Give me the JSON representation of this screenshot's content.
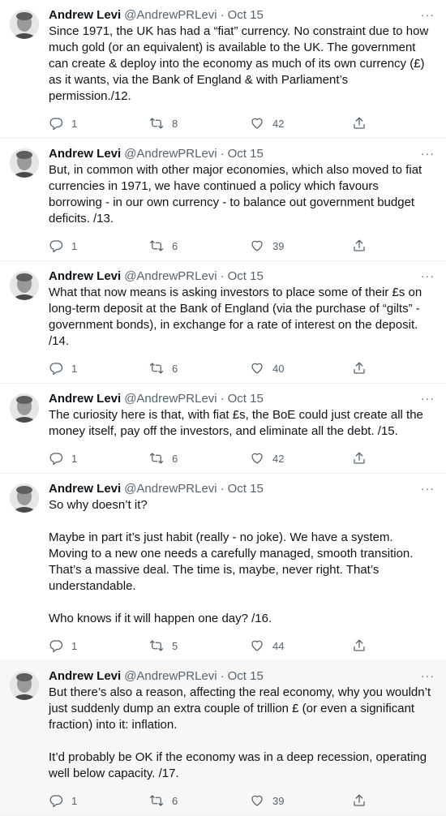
{
  "colors": {
    "text": "#0f1419",
    "secondary": "#536471",
    "divider": "#eff3f4",
    "highlight_bg": "#f7f7f7"
  },
  "icons": {
    "reply": "reply-icon",
    "retweet": "retweet-icon",
    "like": "heart-icon",
    "share": "share-icon",
    "more": "more-icon"
  },
  "tweets": [
    {
      "name": "Andrew Levi",
      "handle": "@AndrewPRLevi",
      "sep": "·",
      "date": "Oct 15",
      "more": "···",
      "paragraphs": [
        "Since 1971, the UK has had a “fiat” currency. No constraint due to how much gold (or an equivalent) is available to the UK. The government can create & deploy into the economy as much of its own currency (£) as it wants, via the Bank of England & with Parliament’s permission./12."
      ],
      "replies": "1",
      "retweets": "8",
      "likes": "42"
    },
    {
      "name": "Andrew Levi",
      "handle": "@AndrewPRLevi",
      "sep": "·",
      "date": "Oct 15",
      "more": "···",
      "paragraphs": [
        "But, in common with other major economies, which also moved to fiat currencies in 1971, we have continued a policy which favours borrowing - in our own currency - to balance out government budget deficits. /13."
      ],
      "replies": "1",
      "retweets": "6",
      "likes": "39"
    },
    {
      "name": "Andrew Levi",
      "handle": "@AndrewPRLevi",
      "sep": "·",
      "date": "Oct 15",
      "more": "···",
      "paragraphs": [
        "What that now means is asking investors to place some of their £s on long-term deposit at the Bank of England (via the purchase of “gilts” - government bonds), in exchange for a rate of interest on the deposit. /14."
      ],
      "replies": "1",
      "retweets": "6",
      "likes": "40"
    },
    {
      "name": "Andrew Levi",
      "handle": "@AndrewPRLevi",
      "sep": "·",
      "date": "Oct 15",
      "more": "···",
      "paragraphs": [
        "The curiosity here is that, with fiat £s, the BoE could just create all the money itself, pay off the investors, and eliminate all the debt. /15."
      ],
      "replies": "1",
      "retweets": "6",
      "likes": "42"
    },
    {
      "name": "Andrew Levi",
      "handle": "@AndrewPRLevi",
      "sep": "·",
      "date": "Oct 15",
      "more": "···",
      "paragraphs": [
        "So why doesn’t it?",
        "Maybe in part it’s just habit (really - no joke). We have a system. Moving to a new one needs a carefully managed, smooth transition. That’s a massive deal. The time is, maybe, never right. That’s understandable.",
        "Who knows if it will happen one day? /16."
      ],
      "replies": "1",
      "retweets": "5",
      "likes": "44"
    },
    {
      "name": "Andrew Levi",
      "handle": "@AndrewPRLevi",
      "sep": "·",
      "date": "Oct 15",
      "more": "···",
      "highlight": true,
      "paragraphs": [
        "But there’s also a reason, affecting the real economy, why you wouldn’t just suddenly dump an extra couple of trillion £ (or even a significant fraction) into it: inflation.",
        "It’d probably be OK if the economy was in a deep recession, operating well below capacity. /17."
      ],
      "replies": "1",
      "retweets": "6",
      "likes": "39"
    }
  ]
}
